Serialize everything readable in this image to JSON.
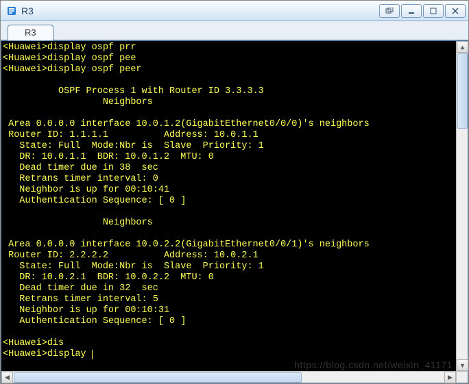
{
  "window": {
    "title": "R3",
    "icon": "app-icon"
  },
  "tabs": [
    {
      "label": "R3",
      "active": true
    }
  ],
  "terminal": {
    "prompt": "<Huawei>",
    "history": [
      {
        "cmd": "display ospf prr"
      },
      {
        "cmd": "display ospf pee"
      },
      {
        "cmd": "display ospf peer"
      }
    ],
    "output": {
      "process_line": "\t  OSPF Process 1 with Router ID 3.3.3.3",
      "neighbors_heading": "\t\t  Neighbors",
      "areas": [
        {
          "area_line": " Area 0.0.0.0 interface 10.0.1.2(GigabitEthernet0/0/0)'s neighbors",
          "router_line": " Router ID: 1.1.1.1          Address: 10.0.1.1",
          "state_line": "   State: Full  Mode:Nbr is  Slave  Priority: 1",
          "dr_line": "   DR: 10.0.1.1  BDR: 10.0.1.2  MTU: 0",
          "dead_line": "   Dead timer due in 38  sec",
          "retrans_line": "   Retrans timer interval: 0",
          "uptime_line": "   Neighbor is up for 00:10:41",
          "auth_line": "   Authentication Sequence: [ 0 ]"
        },
        {
          "area_line": " Area 0.0.0.0 interface 10.0.2.2(GigabitEthernet0/0/1)'s neighbors",
          "router_line": " Router ID: 2.2.2.2          Address: 10.0.2.1",
          "state_line": "   State: Full  Mode:Nbr is  Slave  Priority: 1",
          "dr_line": "   DR: 10.0.2.1  BDR: 10.0.2.2  MTU: 0",
          "dead_line": "   Dead timer due in 32  sec",
          "retrans_line": "   Retrans timer interval: 5",
          "uptime_line": "   Neighbor is up for 00:10:31",
          "auth_line": "   Authentication Sequence: [ 0 ]"
        }
      ]
    },
    "tail": [
      {
        "cmd": "dis"
      },
      {
        "cmd": "display ",
        "cursor": true
      }
    ]
  },
  "watermark": "https://blog.csdn.net/weixin_41171"
}
